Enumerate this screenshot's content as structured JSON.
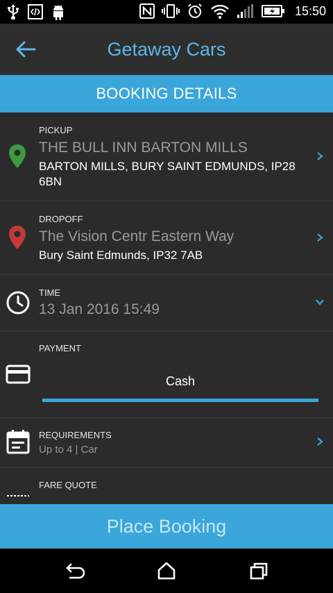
{
  "status_bar": {
    "time": "15:50",
    "icons": [
      "usb-icon",
      "developer-code-icon",
      "android-icon",
      "nfc-icon",
      "vibrate-icon",
      "alarm-icon",
      "wifi-icon",
      "cell-signal-icon",
      "battery-charging-icon"
    ]
  },
  "toolbar": {
    "title": "Getaway Cars"
  },
  "section": {
    "title": "BOOKING DETAILS"
  },
  "pickup": {
    "label": "PICKUP",
    "name": "THE BULL INN BARTON MILLS",
    "address": "BARTON MILLS, BURY SAINT EDMUNDS, IP28 6BN",
    "icon_color": "#3f9a3f"
  },
  "dropoff": {
    "label": "DROPOFF",
    "name": "The Vision Centr Eastern Way",
    "address": "Bury Saint Edmunds, IP32 7AB",
    "icon_color": "#c0393b"
  },
  "time": {
    "label": "TIME",
    "value": "13 Jan 2016 15:49"
  },
  "payment": {
    "label": "PAYMENT",
    "selected": "Cash"
  },
  "requirements": {
    "label": "REQUIREMENTS",
    "value": "Up to 4 | Car"
  },
  "fare": {
    "label": "FARE QUOTE"
  },
  "place_booking": {
    "label": "Place Booking"
  },
  "colors": {
    "accent": "#3aa6d9",
    "title": "#5ab9e6",
    "background": "#2b2b2b"
  }
}
